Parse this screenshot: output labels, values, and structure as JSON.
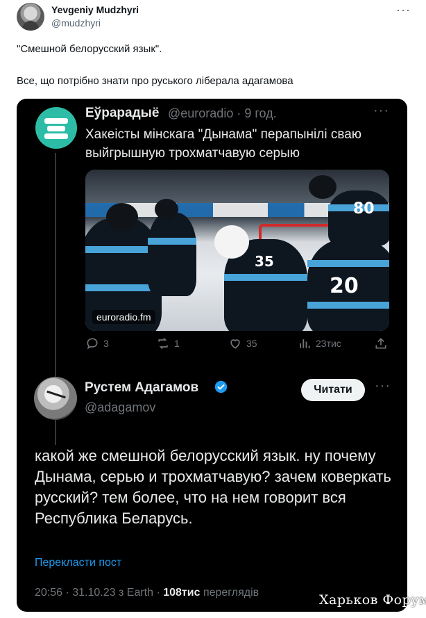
{
  "outer_tweet": {
    "author_name": "Yevgeniy Mudzhyri",
    "author_handle": "@mudzhyri",
    "more_icon": "more-icon",
    "text_line1": "\"Смешной белорусский язык\".",
    "text_line2": "Все, що потрібно знати про руського лібералa адагамова"
  },
  "quoted_tweet": {
    "author_name": "Еўрарадыё",
    "meta": "@euroradio · 9 год.",
    "text": "Хакеісты мінскага \"Дынама\" перапынілі сваю выйгрышную трохматчавую серыю",
    "photo": {
      "caption": "euroradio.fm",
      "numbers": [
        "35",
        "20",
        "80"
      ]
    },
    "actions": {
      "replies": "3",
      "reposts": "1",
      "likes": "35",
      "views": "23тис"
    }
  },
  "main_tweet": {
    "author_name": "Рустем Адагамов",
    "author_handle": "@adagamov",
    "verified": true,
    "read_button": "Читати",
    "text": "какой же смешной белорусский язык. ну почему Дынама, серью и трохматчавую? зачем коверкать русский? тем более, что на нем говорит вся Республика Беларусь.",
    "translate_link": "Перекласти пост",
    "time": "20:56 · 31.10.23 з Earth · ",
    "views_count": "108тис",
    "views_label": " переглядів"
  },
  "watermark": "Харьков Форум",
  "colors": {
    "accent": "#1d9bf0",
    "dark_bg": "#000000",
    "muted": "#71767b",
    "euroradio_teal": "#2dbda6",
    "dinamo_blue": "#48a3d8"
  }
}
